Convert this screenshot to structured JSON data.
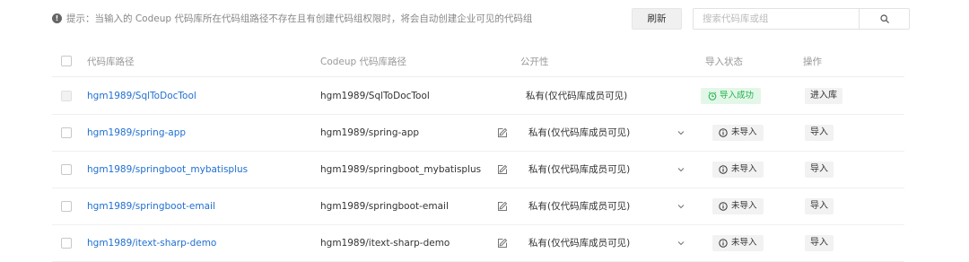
{
  "tip": {
    "icon": "info-icon",
    "text": "提示：当输入的 Codeup 代码库所在代码组路径不存在且有创建代码组权限时，将会自动创建企业可见的代码组"
  },
  "toolbar": {
    "refresh_label": "刷新",
    "search_placeholder": "搜索代码库或组",
    "search_icon": "search-icon"
  },
  "table": {
    "headers": {
      "path": "代码库路径",
      "codeup_path": "Codeup 代码库路径",
      "visibility": "公开性",
      "status": "导入状态",
      "actions": "操作"
    },
    "rows": [
      {
        "path": "hgm1989/SqlToDocTool",
        "codeup_path": "hgm1989/SqlToDocTool",
        "visibility": "私有(仅代码库成员可见)",
        "status": "导入成功",
        "status_type": "success",
        "action": "进入库",
        "editable": false
      },
      {
        "path": "hgm1989/spring-app",
        "codeup_path": "hgm1989/spring-app",
        "visibility": "私有(仅代码库成员可见)",
        "status": "未导入",
        "status_type": "pending",
        "action": "导入",
        "editable": true
      },
      {
        "path": "hgm1989/springboot_mybatisplus",
        "codeup_path": "hgm1989/springboot_mybatisplus",
        "visibility": "私有(仅代码库成员可见)",
        "status": "未导入",
        "status_type": "pending",
        "action": "导入",
        "editable": true
      },
      {
        "path": "hgm1989/springboot-email",
        "codeup_path": "hgm1989/springboot-email",
        "visibility": "私有(仅代码库成员可见)",
        "status": "未导入",
        "status_type": "pending",
        "action": "导入",
        "editable": true
      },
      {
        "path": "hgm1989/itext-sharp-demo",
        "codeup_path": "hgm1989/itext-sharp-demo",
        "visibility": "私有(仅代码库成员可见)",
        "status": "未导入",
        "status_type": "pending",
        "action": "导入",
        "editable": true
      }
    ]
  },
  "colors": {
    "link": "#1f6fd0",
    "success": "#22b14c",
    "success_bg": "#e3f7e8"
  }
}
